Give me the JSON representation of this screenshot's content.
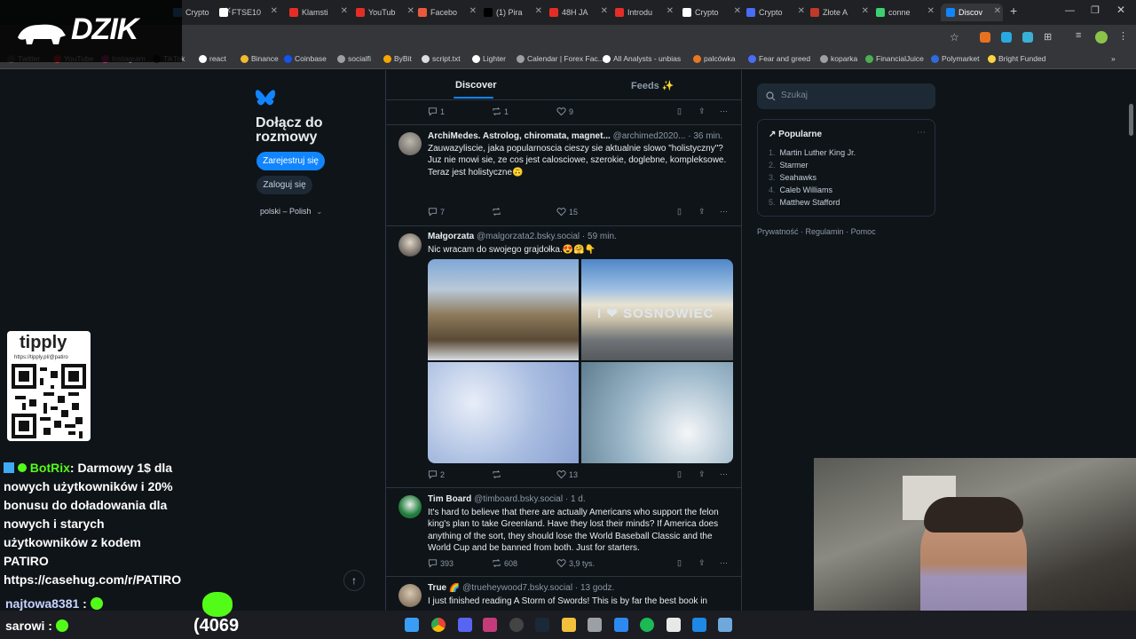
{
  "overlay": {
    "logo_text": "DZIK",
    "tipply_title": "tipply",
    "tipply_url": "https://tipply.pl/@patiro",
    "counter": "(4069"
  },
  "chat": {
    "line1_user": "BotRix",
    "line1_text": ": Darmowy 1$ dla nowych użytkowników i 20% bonusu do doładowania dla nowych i starych użytkowników z kodem PATIRO https://casehug.com/r/PATIRO",
    "line2_user": "najtowa8381",
    "line2_sep": ":",
    "line3_user": "sarowi",
    "line3_sep": ":"
  },
  "browser": {
    "tabs": [
      {
        "label": "Crypto",
        "color": "#4a90e2"
      },
      {
        "label": "FTSE10",
        "color": "#ffffff"
      },
      {
        "label": "Klamsti",
        "color": "#e52d27"
      },
      {
        "label": "YouTub",
        "color": "#e52d27"
      },
      {
        "label": "Facebo",
        "color": "#e85a3c"
      },
      {
        "label": "(1) Pira",
        "color": "#000000"
      },
      {
        "label": "48H JA",
        "color": "#e52d27"
      },
      {
        "label": "Introdu",
        "color": "#e52d27"
      },
      {
        "label": "Crypto",
        "color": "#ffffff"
      },
      {
        "label": "Crypto",
        "color": "#4a6cf7"
      },
      {
        "label": "Złote A",
        "color": "#c0392b"
      },
      {
        "label": "conne",
        "color": "#3cd070"
      },
      {
        "label": "Discov",
        "color": "#1185fe"
      }
    ],
    "bookmarks": [
      {
        "label": "Twitter"
      },
      {
        "label": "YouTube"
      },
      {
        "label": "Instagram"
      },
      {
        "label": "TikTok"
      },
      {
        "label": "react"
      },
      {
        "label": "Binance"
      },
      {
        "label": "Coinbase"
      },
      {
        "label": "socialfi"
      },
      {
        "label": "ByBit"
      },
      {
        "label": "script.txt"
      },
      {
        "label": "Lighter"
      },
      {
        "label": "Calendar | Forex Fac..."
      },
      {
        "label": "All Analysts - unbias"
      },
      {
        "label": "palcówka"
      },
      {
        "label": "Fear and greed"
      },
      {
        "label": "koparka"
      },
      {
        "label": "FinancialJuice"
      },
      {
        "label": "Polymarket"
      },
      {
        "label": "Bright Funded"
      }
    ]
  },
  "left": {
    "title": "Dołącz do rozmowy",
    "signup": "Zarejestruj się",
    "login": "Zaloguj się",
    "language": "polski – Polish"
  },
  "tabs": {
    "discover": "Discover",
    "feeds": "Feeds ✨"
  },
  "posts": [
    {
      "name": "",
      "handle": "",
      "time": "",
      "text": "",
      "replies": "1",
      "reposts": "1",
      "likes": "9"
    },
    {
      "name": "ArchiMedes. Astrolog, chiromata, magnet...",
      "handle": "@archimed2020...",
      "time": "· 36 min.",
      "text": "Zauwazyliscie, jaka popularnoscia cieszy sie aktualnie slowo \"holistyczny\"?\nJuz nie mowi sie, ze cos jest calosciowe, szerokie, doglebne, kompleksowe.\nTeraz jest holistyczne🙃",
      "replies": "7",
      "reposts": "",
      "likes": "15"
    },
    {
      "name": "Małgorzata",
      "handle": "@malgorzata2.bsky.social",
      "time": "· 59 min.",
      "text": "Nic wracam do swojego grajdołka.😍🤗👇",
      "image_text": "I ❤ SOSNOWIEC",
      "replies": "2",
      "reposts": "",
      "likes": "13"
    },
    {
      "name": "Tim Board",
      "handle": "@timboard.bsky.social",
      "time": "· 1 d.",
      "text": "It's hard to believe that there are actually Americans who support the felon king's plan to take Greenland. Have they lost their minds? If America does anything of the sort, they should lose the World Baseball Classic and the World Cup and be banned from both. Just for starters.",
      "replies": "393",
      "reposts": "608",
      "likes": "3,9 tys."
    },
    {
      "name": "True 🌈",
      "handle": "@trueheywood7.bsky.social",
      "time": "· 13 godz.",
      "text": "I just finished reading A Storm of Swords! This is by far the best book in"
    }
  ],
  "right": {
    "search_placeholder": "Szukaj",
    "trending_title": "Popularne",
    "trending": [
      "Martin Luther King Jr.",
      "Starmer",
      "Seahawks",
      "Caleb Williams",
      "Matthew Stafford"
    ],
    "footer": [
      "Prywatność",
      "Regulamin",
      "Pomoc"
    ]
  }
}
